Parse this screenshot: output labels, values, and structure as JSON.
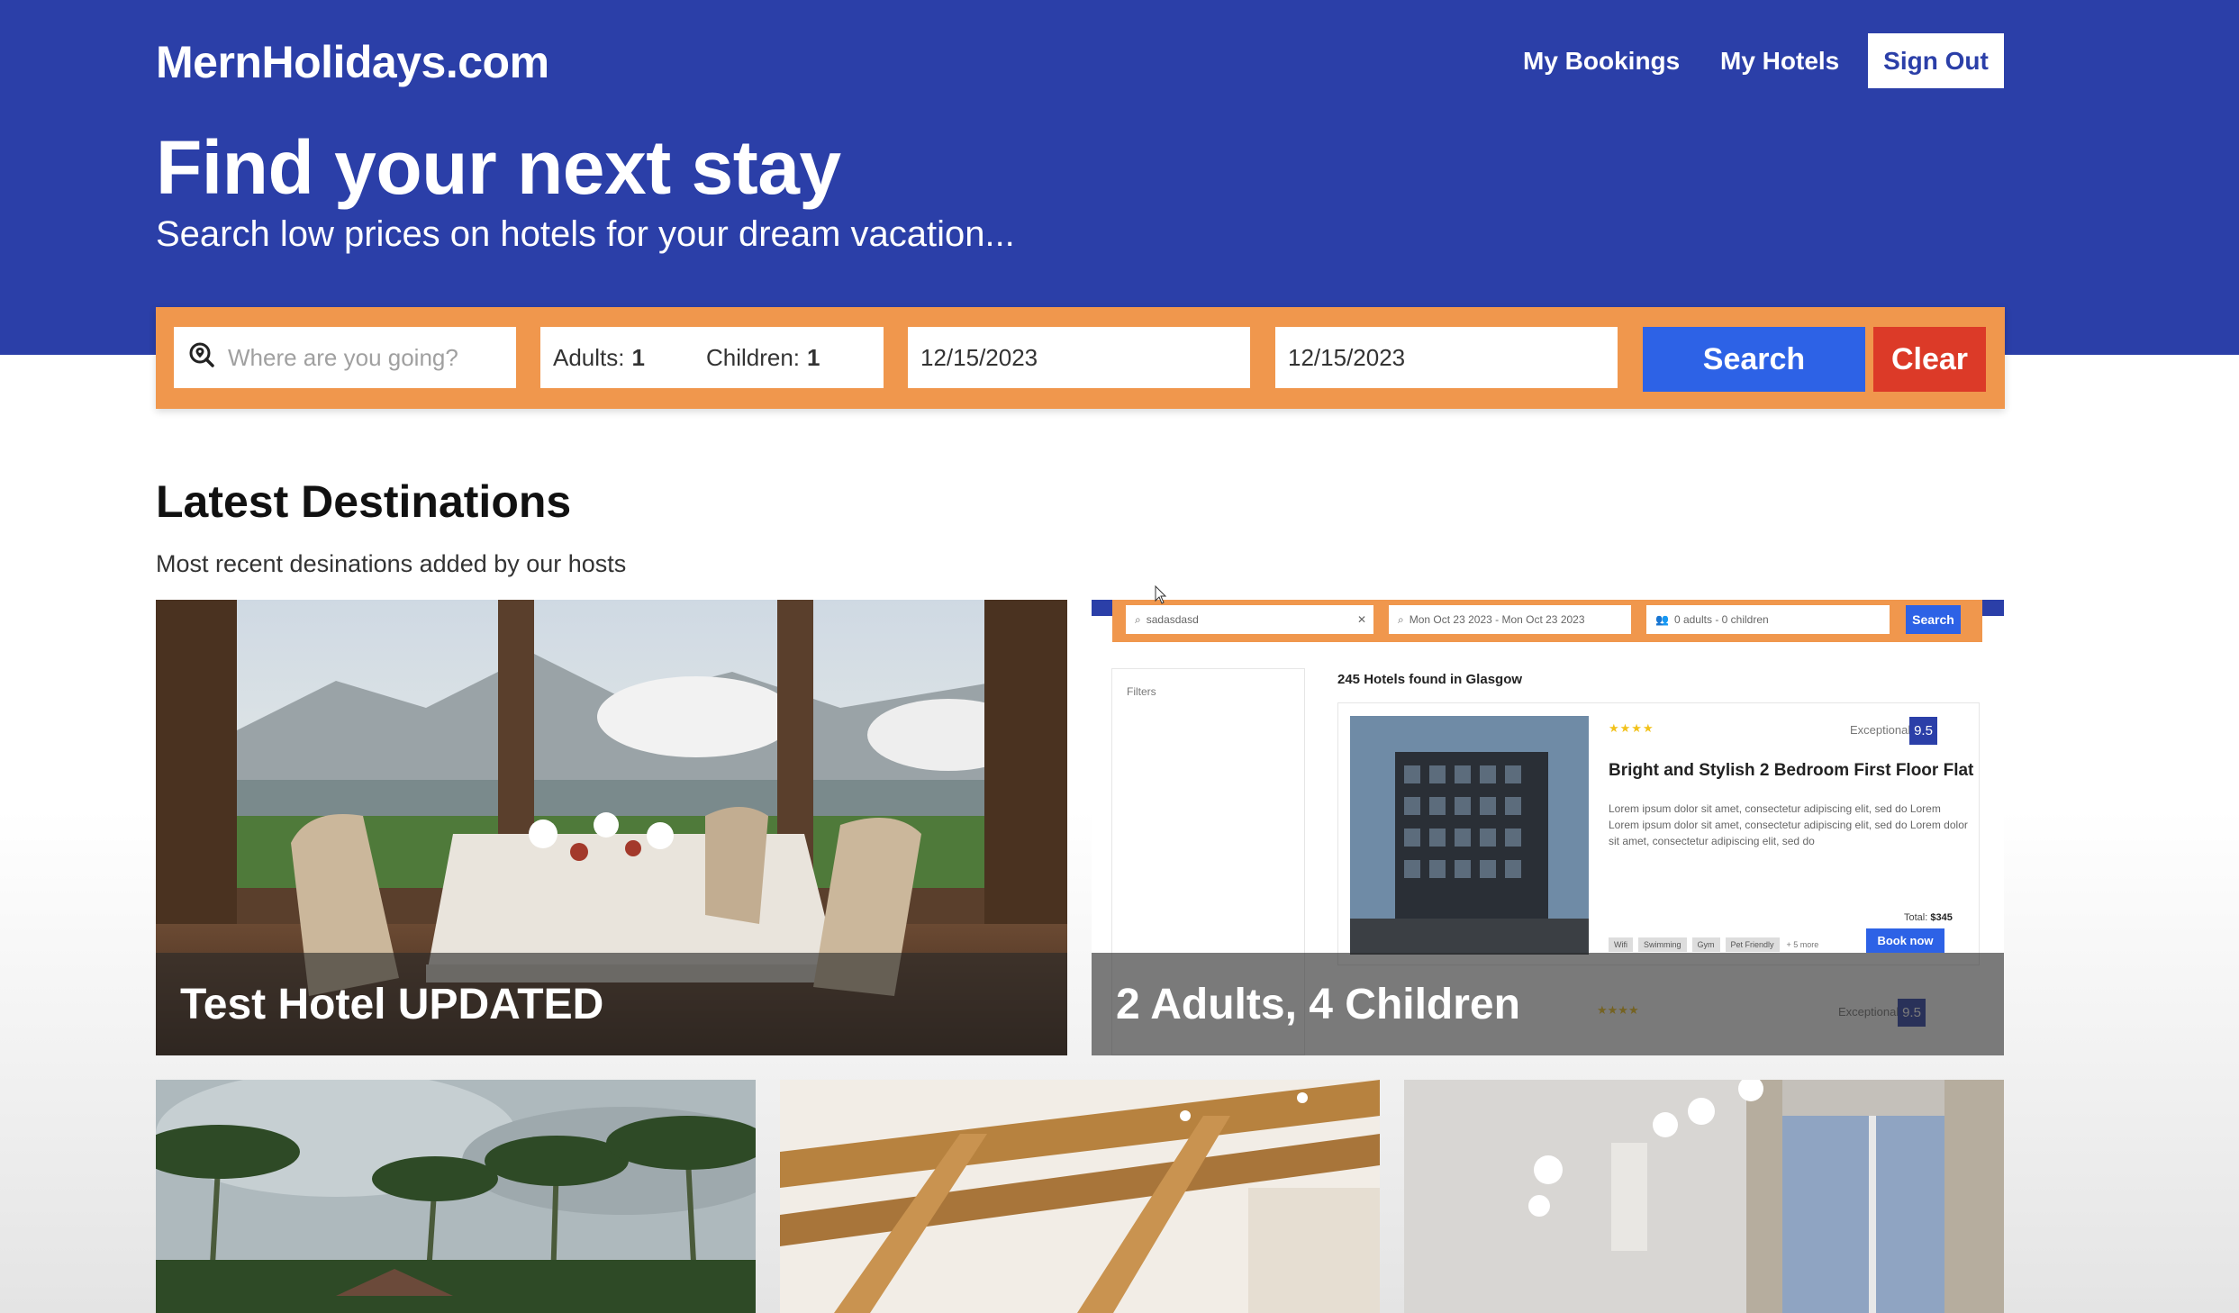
{
  "header": {
    "logo": "MernHolidays.com",
    "nav": {
      "my_bookings": "My Bookings",
      "my_hotels": "My Hotels",
      "sign_out": "Sign Out"
    },
    "title": "Find your next stay",
    "subtitle": "Search low prices on hotels for your dream vacation..."
  },
  "search": {
    "destination_placeholder": "Where are you going?",
    "adults_label": "Adults:",
    "adults_value": "1",
    "children_label": "Children:",
    "children_value": "1",
    "check_in": "12/15/2023",
    "check_out": "12/15/2023",
    "search_label": "Search",
    "clear_label": "Clear"
  },
  "destinations": {
    "title": "Latest Destinations",
    "subtitle": "Most recent desinations added by our hosts",
    "cards": [
      {
        "name": "Test Hotel UPDATED"
      },
      {
        "name": "2 Adults, 4 Children"
      }
    ],
    "embedded_screenshot": {
      "dest": "sadasdasd",
      "dates": "Mon Oct 23 2023 - Mon Oct 23 2023",
      "guests": "0 adults - 0 children",
      "search": "Search",
      "filters": "Filters",
      "found": "245 Hotels found in Glasgow",
      "stars": "★★★★",
      "rating_label": "Exceptional",
      "rating": "9.5",
      "hotel_title": "Bright and Stylish 2 Bedroom First Floor Flat",
      "description": "Lorem ipsum dolor sit amet, consectetur adipiscing elit, sed do Lorem Lorem ipsum dolor sit amet, consectetur adipiscing elit, sed do Lorem dolor sit amet, consectetur adipiscing elit, sed do",
      "total_label": "Total:",
      "total_value": "$345",
      "book_now": "Book now",
      "tags": [
        "Wifi",
        "Swimming",
        "Gym",
        "Pet Friendly"
      ],
      "more": "+ 5 more"
    }
  },
  "colors": {
    "brand_blue": "#2b3fa8",
    "search_orange": "#f0974d",
    "button_blue": "#2d62e6",
    "button_red": "#dc3a28"
  }
}
